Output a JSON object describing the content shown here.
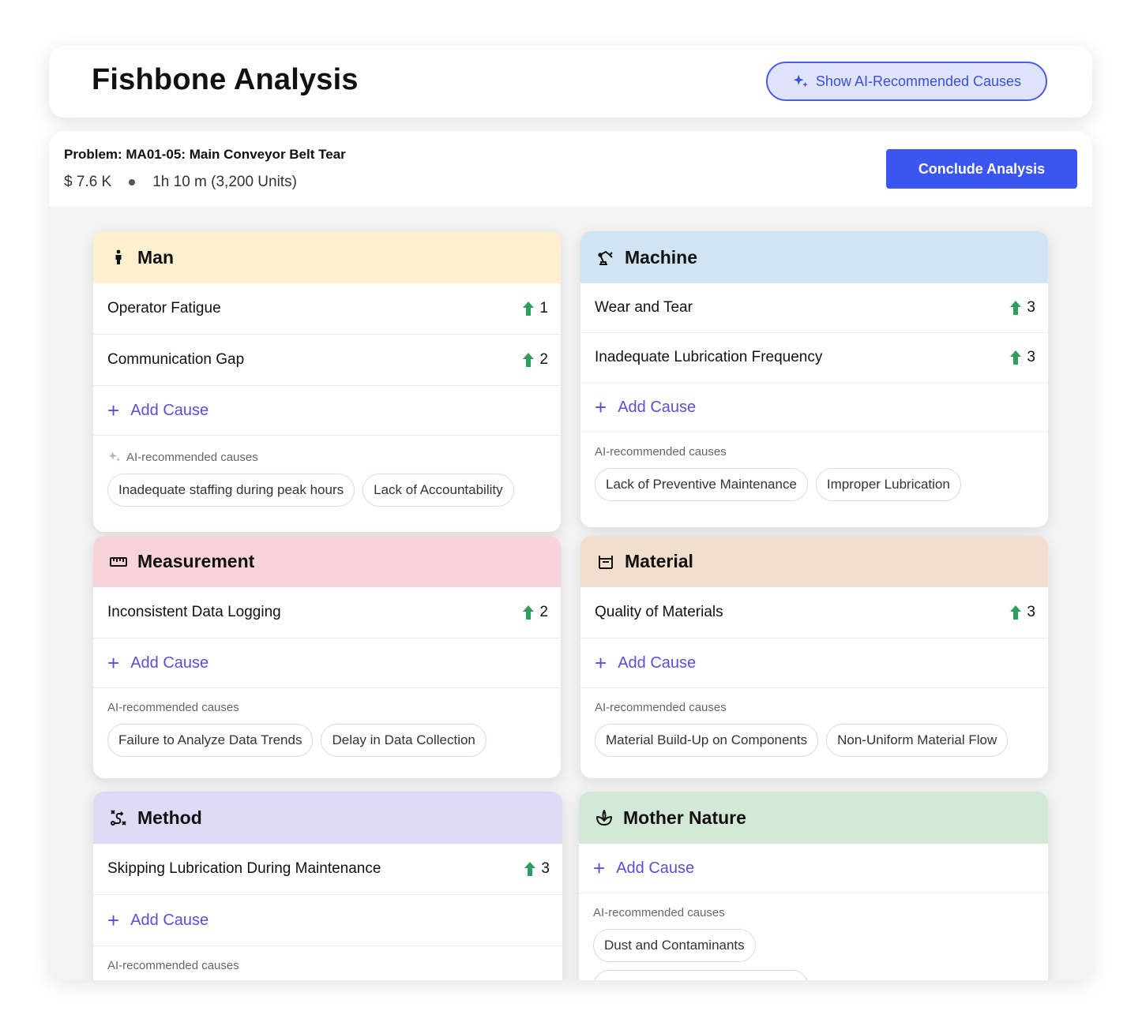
{
  "header": {
    "title": "Fishbone Analysis",
    "ai_button_label": "Show AI-Recommended Causes"
  },
  "problem": {
    "title": "Problem: MA01-05: Main Conveyor Belt Tear",
    "cost": "$ 7.6 K",
    "duration": "1h 10 m (3,200 Units)",
    "conclude_label": "Conclude Analysis"
  },
  "colors": {
    "accent": "#3a55f0",
    "vote_arrow": "#2e9e5e",
    "man": "#fdf0cf",
    "machine": "#cfe5f3",
    "measurement": "#f9d3da",
    "material": "#f2decd",
    "method": "#dedaf6",
    "mother_nature": "#d4e8d8"
  },
  "categories": {
    "man": {
      "name": "Man",
      "icon": "person-icon",
      "causes": [
        {
          "label": "Operator Fatigue",
          "votes": "1"
        },
        {
          "label": "Communication Gap",
          "votes": "2"
        }
      ],
      "add_label": "Add Cause",
      "ai_label": "AI-recommended causes",
      "ai_causes": [
        "Inadequate staffing during peak hours",
        "Lack of Accountability"
      ]
    },
    "machine": {
      "name": "Machine",
      "icon": "robot-arm-icon",
      "causes": [
        {
          "label": "Wear and Tear",
          "votes": "3"
        },
        {
          "label": "Inadequate Lubrication Frequency",
          "votes": "3"
        }
      ],
      "add_label": "Add Cause",
      "ai_label": "AI-recommended causes",
      "ai_causes": [
        "Lack of Preventive Maintenance",
        "Improper Lubrication"
      ]
    },
    "measurement": {
      "name": "Measurement",
      "icon": "ruler-icon",
      "causes": [
        {
          "label": "Inconsistent Data Logging",
          "votes": "2"
        }
      ],
      "add_label": "Add Cause",
      "ai_label": "AI-recommended causes",
      "ai_causes": [
        "Failure to Analyze Data Trends",
        "Delay in Data Collection"
      ]
    },
    "material": {
      "name": "Material",
      "icon": "material-bin-icon",
      "causes": [
        {
          "label": "Quality of Materials",
          "votes": "3"
        }
      ],
      "add_label": "Add Cause",
      "ai_label": "AI-recommended causes",
      "ai_causes": [
        "Material Build-Up on Components",
        "Non-Uniform Material Flow"
      ]
    },
    "method": {
      "name": "Method",
      "icon": "route-icon",
      "causes": [
        {
          "label": "Skipping Lubrication During Maintenance",
          "votes": "3"
        }
      ],
      "add_label": "Add Cause",
      "ai_label": "AI-recommended causes"
    },
    "mother_nature": {
      "name": "Mother Nature",
      "icon": "leaf-icon",
      "add_label": "Add Cause",
      "ai_label": "AI-recommended causes",
      "ai_causes": [
        "Dust and Contaminants"
      ]
    }
  }
}
